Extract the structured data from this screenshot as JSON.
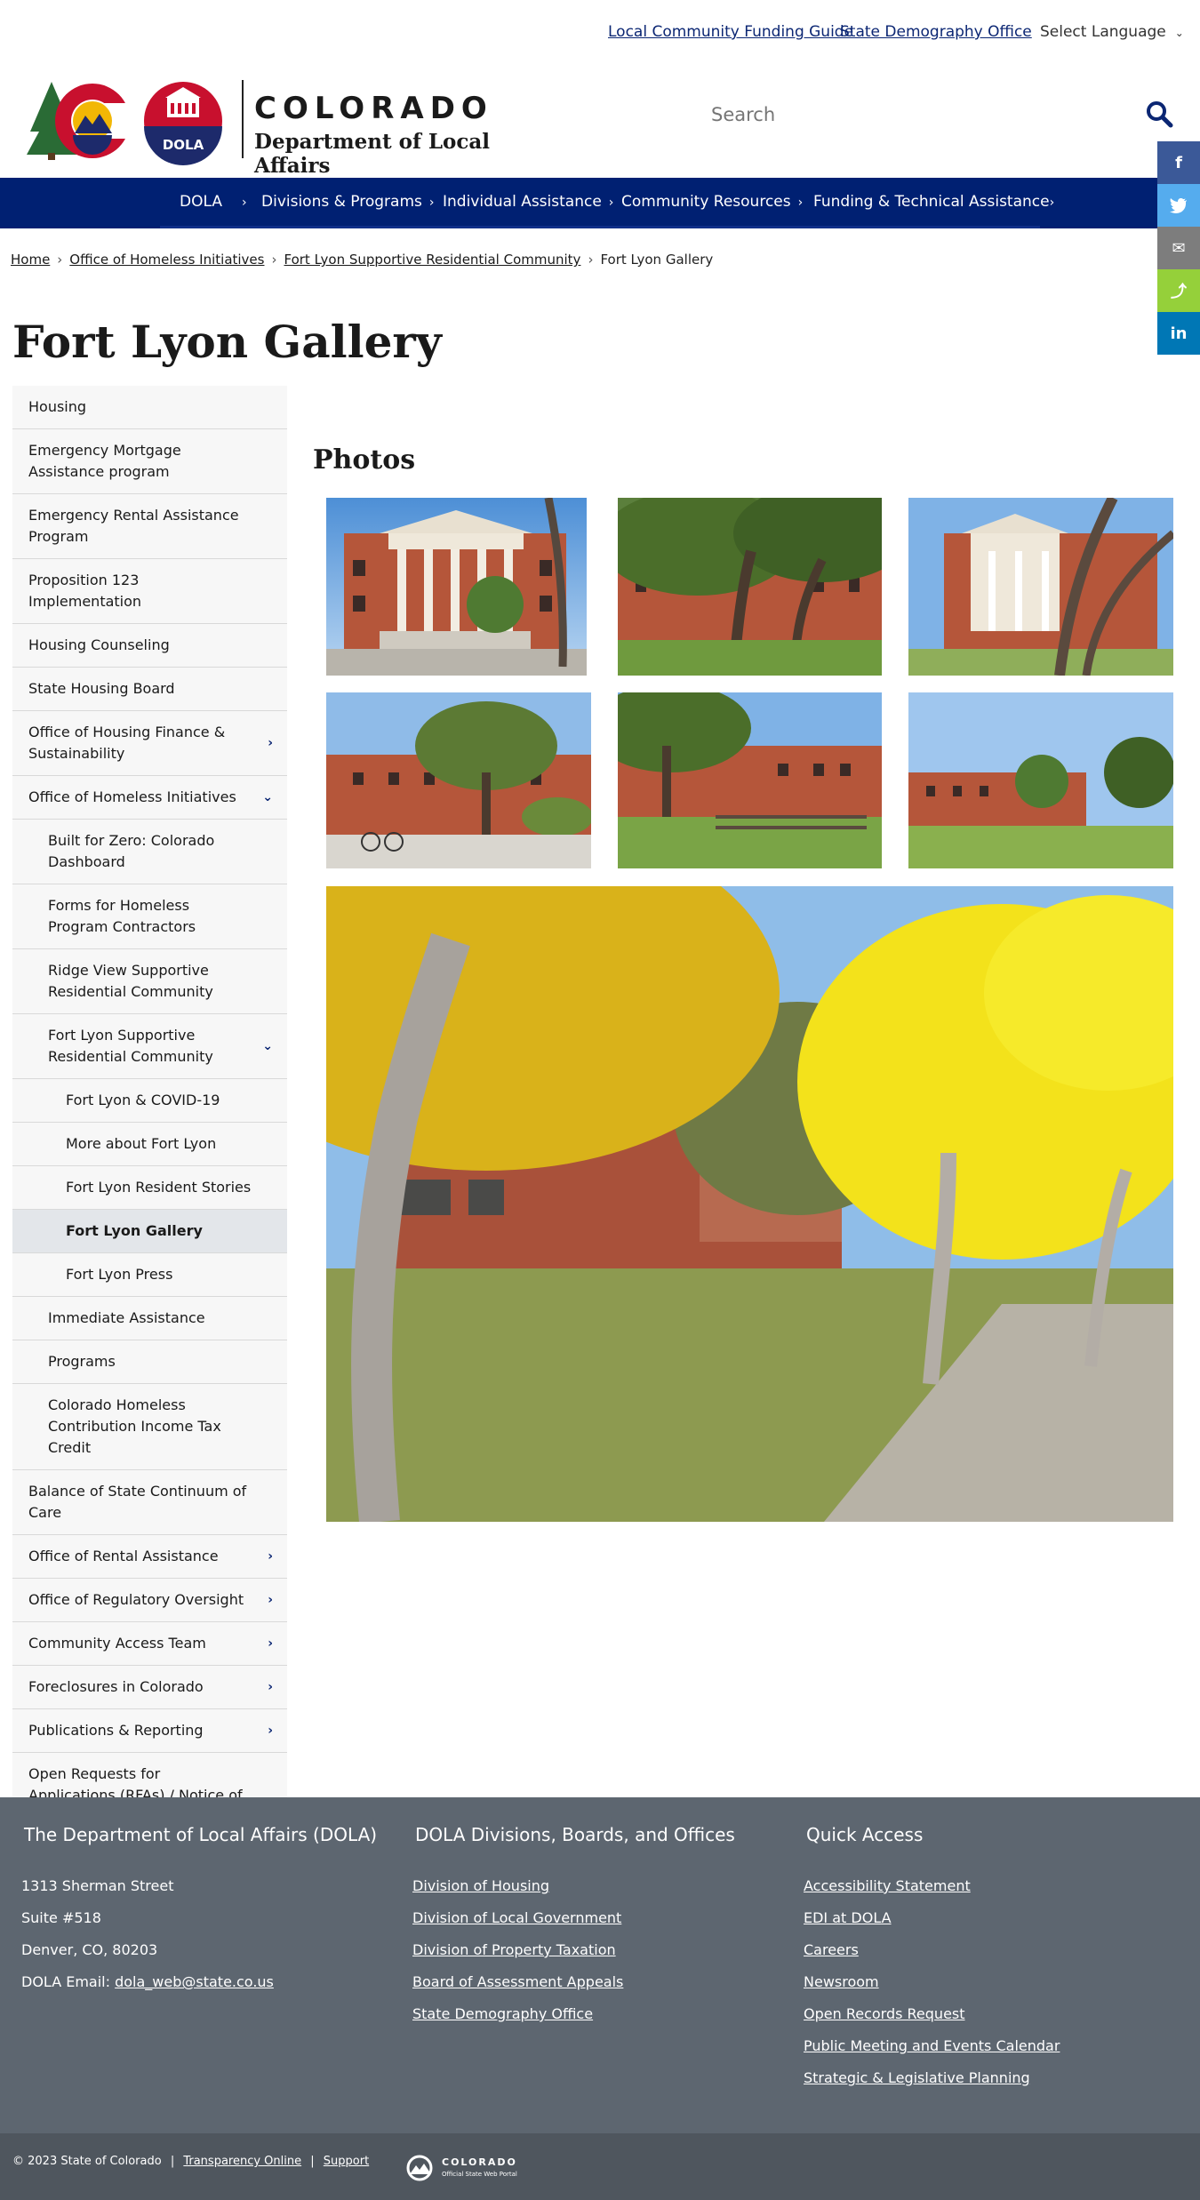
{
  "utility": {
    "link_1": "Local Community Funding Guide",
    "link_2": "State Demography Office",
    "language": "Select Language"
  },
  "header": {
    "brand_word": "COLORADO",
    "brand_sub": "Department of Local Affairs",
    "badge_text": "DOLA",
    "search_placeholder": "Search"
  },
  "nav": {
    "items": [
      {
        "label": "DOLA"
      },
      {
        "label": "Divisions & Programs"
      },
      {
        "label": "Individual Assistance"
      },
      {
        "label": "Community Resources"
      },
      {
        "label": "Funding & Technical Assistance"
      }
    ]
  },
  "share": {
    "facebook": "f",
    "twitter": "t",
    "email": "✉",
    "share": "⤴",
    "linkedin": "in"
  },
  "breadcrumb": {
    "items": [
      "Home",
      "Office of Homeless Initiatives",
      "Fort Lyon Supportive Residential Community"
    ],
    "current": "Fort Lyon Gallery"
  },
  "page": {
    "title": "Fort Lyon Gallery",
    "section": "Photos"
  },
  "sidebar": {
    "items": [
      {
        "label": "Housing"
      },
      {
        "label": "Emergency Mortgage Assistance program"
      },
      {
        "label": "Emergency Rental Assistance Program"
      },
      {
        "label": "Proposition 123 Implementation"
      },
      {
        "label": "Housing Counseling"
      },
      {
        "label": "State Housing Board"
      },
      {
        "label": "Office of Housing Finance & Sustainability"
      },
      {
        "label": "Office of Homeless Initiatives"
      },
      {
        "label": "Built for Zero: Colorado Dashboard"
      },
      {
        "label": "Forms for Homeless Program Contractors"
      },
      {
        "label": "Ridge View Supportive Residential Community"
      },
      {
        "label": "Fort Lyon Supportive Residential Community"
      },
      {
        "label": "Fort Lyon & COVID-19"
      },
      {
        "label": "More about Fort Lyon"
      },
      {
        "label": "Fort Lyon Resident Stories"
      },
      {
        "label": "Fort Lyon Gallery"
      },
      {
        "label": "Fort Lyon Press"
      },
      {
        "label": "Immediate Assistance"
      },
      {
        "label": "Programs"
      },
      {
        "label": "Colorado Homeless Contribution Income Tax Credit"
      },
      {
        "label": "Balance of State Continuum of Care"
      },
      {
        "label": "Office of Rental Assistance"
      },
      {
        "label": "Office of Regulatory Oversight"
      },
      {
        "label": "Community Access Team"
      },
      {
        "label": "Foreclosures in Colorado"
      },
      {
        "label": "Publications & Reporting"
      },
      {
        "label": "Open Requests for Applications (RFAs) / Notice of Funding Availabilities (NOFA)"
      }
    ]
  },
  "footer": {
    "col1": {
      "heading": "The Department of Local Affairs (DOLA)",
      "address1": "1313 Sherman Street",
      "address2": "Suite  #518",
      "address3": "Denver, CO, 80203",
      "email_label": "DOLA Email:",
      "email": "dola_web@state.co.us"
    },
    "col2": {
      "heading": "DOLA Divisions, Boards, and Offices",
      "links": [
        "Division of Housing",
        "Division of Local Government",
        "Division of Property Taxation",
        "Board of Assessment Appeals",
        "State Demography Office"
      ]
    },
    "col3": {
      "heading": "Quick Access",
      "links": [
        "Accessibility Statement",
        "EDI at DOLA",
        "Careers",
        "Newsroom",
        "Open Records Request",
        "Public Meeting and Events Calendar",
        "Strategic & Legislative Planning"
      ]
    },
    "bottom": {
      "copyright": "© 2023 State of Colorado",
      "sep": "|",
      "transparency": "Transparency Online",
      "support": "Support",
      "portal_word": "COLORADO",
      "portal_sub": "Official State Web Portal"
    }
  },
  "colors": {
    "nav_bg": "#002072",
    "link": "#0b2673",
    "footer_bg": "#5d6670",
    "facebook": "#3b5998",
    "twitter": "#55acee",
    "email": "#7d7d7d",
    "share": "#95d03a",
    "linkedin": "#0077b5"
  }
}
